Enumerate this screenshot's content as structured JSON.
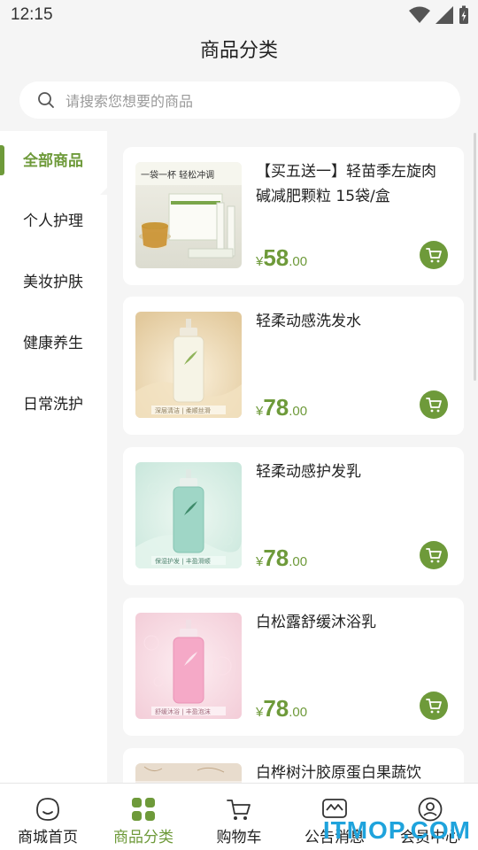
{
  "status": {
    "time": "12:15"
  },
  "header": {
    "title": "商品分类"
  },
  "search": {
    "placeholder": "请搜索您想要的商品"
  },
  "sidebar": {
    "items": [
      {
        "label": "全部商品",
        "active": true
      },
      {
        "label": "个人护理",
        "active": false
      },
      {
        "label": "美妆护肤",
        "active": false
      },
      {
        "label": "健康养生",
        "active": false
      },
      {
        "label": "日常洗护",
        "active": false
      }
    ]
  },
  "products": [
    {
      "name": "【买五送一】轻苗季左旋肉碱减肥颗粒 15袋/盒",
      "currency": "¥",
      "price_int": "58",
      "price_dec": ".00",
      "image_caption": "一袋一杯  轻松冲调"
    },
    {
      "name": "轻柔动感洗发水",
      "currency": "¥",
      "price_int": "78",
      "price_dec": ".00",
      "image_caption": "深层清洁 | 柔顺丝滑"
    },
    {
      "name": "轻柔动感护发乳",
      "currency": "¥",
      "price_int": "78",
      "price_dec": ".00",
      "image_caption": "保湿护发 | 丰盈滑顺"
    },
    {
      "name": "白松露舒缓沐浴乳",
      "currency": "¥",
      "price_int": "78",
      "price_dec": ".00",
      "image_caption": "舒缓沐浴 | 丰盈泡沫"
    },
    {
      "name": "白桦树汁胶原蛋白果蔬饮",
      "currency": "¥",
      "price_int": "",
      "price_dec": "",
      "image_caption": ""
    }
  ],
  "tabbar": {
    "items": [
      {
        "label": "商城首页",
        "icon": "home-face-icon",
        "active": false
      },
      {
        "label": "商品分类",
        "icon": "grid-icon",
        "active": true
      },
      {
        "label": "购物车",
        "icon": "cart-icon",
        "active": false
      },
      {
        "label": "公告消息",
        "icon": "message-icon",
        "active": false
      },
      {
        "label": "会员中心",
        "icon": "user-icon",
        "active": false
      }
    ]
  },
  "watermark": "ITMOP.COM",
  "colors": {
    "accent": "#6e9a3a",
    "background": "#f5f5f5"
  }
}
